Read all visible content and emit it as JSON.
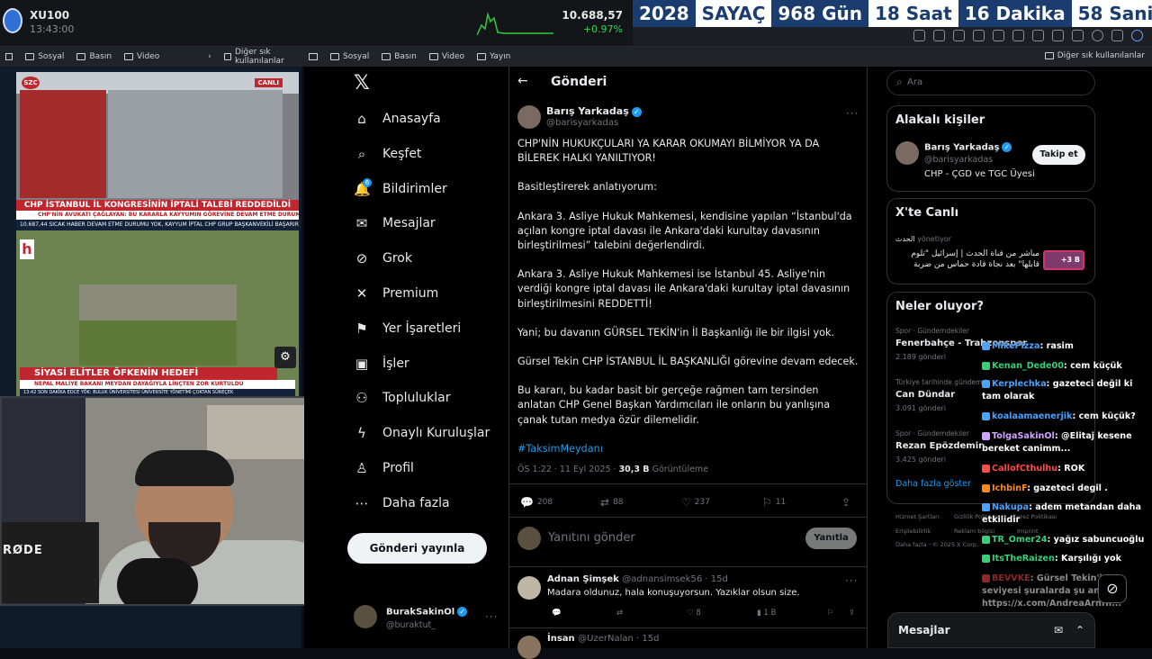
{
  "ticker": {
    "symbol": "XU100",
    "time": "13:43:00",
    "price": "10.688,57",
    "change": "+0.97%"
  },
  "countdown": {
    "year": "2028",
    "label": "SAYAÇ",
    "days": "968 Gün",
    "hours": "18 Saat",
    "minutes": "16 Dakika",
    "seconds": "58 Saniye"
  },
  "bookmarks": {
    "social": "Sosyal",
    "press": "Basın",
    "video": "Video",
    "stream": "Yayın",
    "other": "Diğer sık kullanılanlar"
  },
  "tv1": {
    "channel": "SZC",
    "live": "CANLI",
    "headline": "CHP İSTANBUL İL KONGRESİNİN İPTALİ TALEBİ REDDEDİLDİ",
    "sub": "CHP'NİN AVUKATI ÇAĞLAYAN: BU KARARLA KAYYUMIN GÖREVİNE DEVAM ETME DURUMU YOK",
    "crawl": "10.687,44  SICAK HABER  DEVAM ETME DURUMU YOK, KAYYUM İPTAL  CHP GRUP BAŞKANVEKİLİ BAŞARIR  13:42"
  },
  "tv2": {
    "logo": "h",
    "headline": "SİYASİ ELİTLER ÖFKENİN HEDEFİ",
    "sub": "NEPAL MALİYE BAKANI MEYDAN DAYAĞIYLA LİNÇTEN ZOR KURTULDU",
    "crawl": "13:42  SON DAKİKA  EDCE  YÖK: BULUK ÜNİVERSİTESİ ÜNİVERSİTE YÖNETİMİ ÇOKTAN SÜREÇEK"
  },
  "cam": {
    "mic_brand": "RØDE"
  },
  "nav": {
    "items": [
      {
        "label": "Anasayfa",
        "icon": "⌂"
      },
      {
        "label": "Keşfet",
        "icon": "⌕"
      },
      {
        "label": "Bildirimler",
        "icon": "🔔"
      },
      {
        "label": "Mesajlar",
        "icon": "✉"
      },
      {
        "label": "Grok",
        "icon": "⊘"
      },
      {
        "label": "Premium",
        "icon": "✕"
      },
      {
        "label": "Yer İşaretleri",
        "icon": "⚑"
      },
      {
        "label": "İşler",
        "icon": "▣"
      },
      {
        "label": "Topluluklar",
        "icon": "⚇"
      },
      {
        "label": "Onaylı Kuruluşlar",
        "icon": "ϟ"
      },
      {
        "label": "Profil",
        "icon": "♙"
      },
      {
        "label": "Daha fazla",
        "icon": "⋯"
      }
    ],
    "notif_count": "6",
    "post_button": "Gönderi yayınla",
    "account_name": "BurakSakinOl",
    "account_handle": "@buraktut_"
  },
  "post": {
    "header": "Gönderi",
    "author": "Barış Yarkadaş",
    "handle": "@barisyarkadas",
    "paragraphs": [
      "CHP'NİN HUKUKÇULARI YA KARAR OKUMAYI BİLMİYOR YA DA BİLEREK HALKI YANILTIYOR!",
      "Basitleştirerek anlatıyorum:",
      "Ankara 3. Asliye Hukuk Mahkemesi, kendisine yapılan “İstanbul'da açılan kongre iptal davası ile Ankara'daki kurultay davasının birleştirilmesi” talebini değerlendirdi.",
      "Ankara 3. Asliye Hukuk Mahkemesi ise İstanbul 45. Asliye'nin verdiği kongre iptal davası ile Ankara'daki kurultay iptal davasının birleştirilmesini REDDETTİ!",
      "Yani; bu davanın GÜRSEL TEKİN'in İl Başkanlığı ile bir ilgisi yok.",
      "Gürsel Tekin CHP İSTANBUL İL BAŞKANLIĞI görevine devam edecek.",
      "Bu kararı, bu kadar basit bir gerçeğe rağmen tam tersinden anlatan CHP Genel Başkan Yardımcıları ile onların bu yanlışına çanak tutan medya özür dilemelidir."
    ],
    "hashtag": "#TaksimMeydanı",
    "time": "ÖS 1:22 · 11 Eyl 2025 · ",
    "views": "30,3 B",
    "views_label": " Görüntüleme",
    "replies": "208",
    "reposts": "88",
    "likes": "237",
    "bookmarks": "11",
    "reply_placeholder": "Yanıtını gönder",
    "reply_button": "Yanıtla"
  },
  "comments": [
    {
      "name": "Adnan Şimşek",
      "handle": "@adnansimsek56 · 15d",
      "text": "Madara oldunuz, hala konuşuyorsun. Yazıklar olsun size.",
      "reposts": "",
      "likes": "8",
      "views": "1 B"
    },
    {
      "name": "İnsan",
      "handle": "@UzerNalan · 15d",
      "text": "",
      "reposts": "",
      "likes": "",
      "views": ""
    }
  ],
  "right": {
    "search_placeholder": "Ara",
    "related_title": "Alakalı kişiler",
    "related_name": "Barış Yarkadaş",
    "related_handle": "@barisyarkadas",
    "related_bio": "CHP - ÇGD ve TGC Üyesi",
    "follow": "Takip et",
    "live_title": "X'te Canlı",
    "live_host": "الحدث",
    "live_role": "yönetiyor",
    "live_text": "مباشر من قناة الحدث | إسرائيل \"تلوم قابلها\" بعد نجاة قادة حماس من ضربة",
    "live_count": "+3 B",
    "trend_title": "Neler oluyor?",
    "trends": [
      {
        "cat": "Spor · Gündemdekiler",
        "name": "Fenerbahçe - Trabzonspor",
        "count": "2.189 gönderi"
      },
      {
        "cat": "Türkiye tarihinde gündemde",
        "name": "Can Dündar",
        "count": "3.091 gönderi"
      },
      {
        "cat": "Spor · Gündemdekiler",
        "name": "Rezan Epözdemir",
        "count": "3.425 gönderi"
      }
    ],
    "more": "Daha fazla göster",
    "footer": [
      "Hizmet Şartları",
      "Gizlilik Politikası",
      "Çerez Politikası",
      "Erişilebilirlik",
      "Reklam bilgisi",
      "Imprint",
      "Daha fazla ···",
      "© 2025 X Corp."
    ],
    "messages": "Mesajlar"
  },
  "chat": [
    {
      "user": "MikePizza",
      "text": "rasim",
      "color": "#4aa3ff"
    },
    {
      "user": "Kenan_Dede00",
      "text": "cem küçük",
      "color": "#36d07a"
    },
    {
      "user": "Kerplechka",
      "text": "gazeteci değil ki tam olarak",
      "color": "#4aa3ff"
    },
    {
      "user": "koalaamaenerjik",
      "text": "cem küçük?",
      "color": "#4aa3ff"
    },
    {
      "user": "TolgaSakinOl",
      "text": "@Elitaj kesene bereket canimm...",
      "color": "#d1a3ff"
    },
    {
      "user": "CallofCthulhu",
      "text": "ROK",
      "color": "#ff4a4a"
    },
    {
      "user": "IchbinF",
      "text": "gazeteci degil .",
      "color": "#ff8a1a"
    },
    {
      "user": "Nakupa",
      "text": "adem metandan daha etkilidir",
      "color": "#4aa3ff"
    },
    {
      "user": "TR_Omer24",
      "text": "yağız sabuncuoğlu",
      "color": "#36d07a"
    },
    {
      "user": "ItsTheRaizen",
      "text": "Karşılığı yok",
      "color": "#36d07a"
    },
    {
      "user": "BEVVKE",
      "text": "Gürsel Tekin'in ... seviyesi şuralarda şu an https://x.com/AndreaArnHr...",
      "color": "#ff4a4a"
    }
  ]
}
